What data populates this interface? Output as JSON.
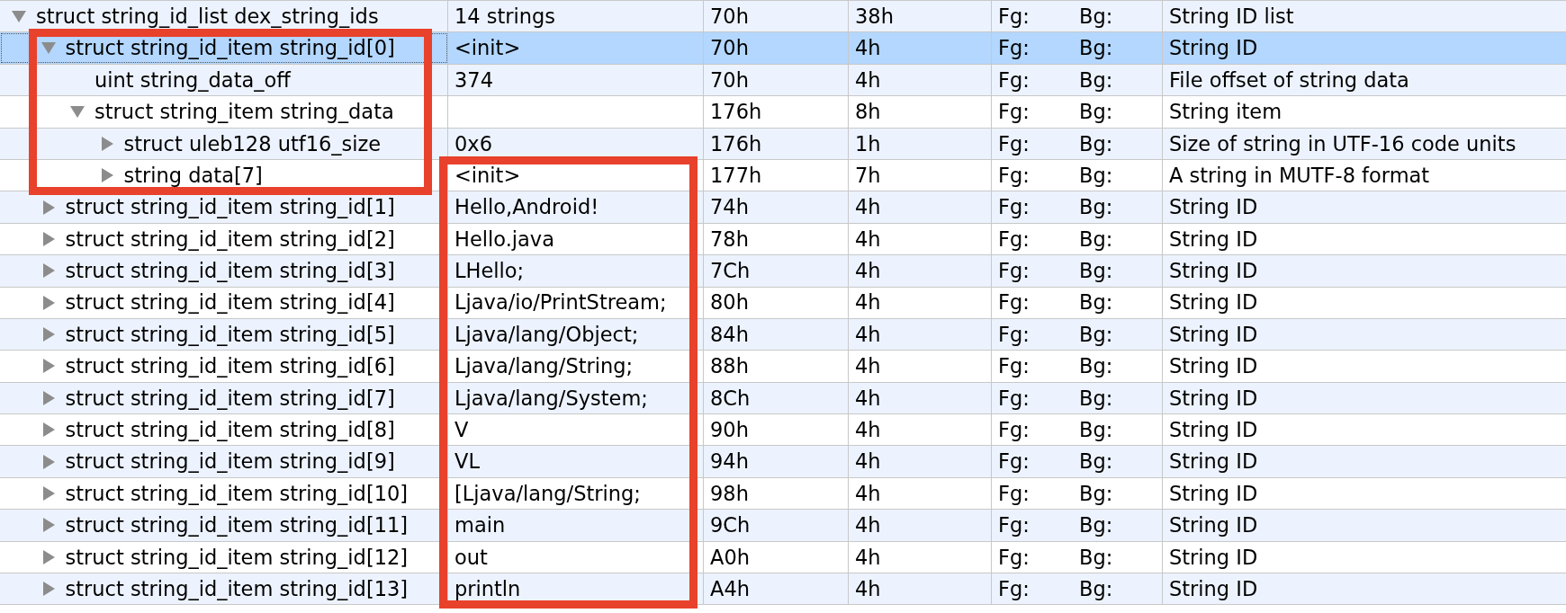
{
  "table": {
    "rows": [
      {
        "name": "struct string_id_list dex_string_ids",
        "value": "14 strings",
        "start": "70h",
        "size": "38h",
        "fg": "Fg:",
        "bg": "Bg:",
        "comment": "String ID list",
        "selected": false,
        "expanded": true,
        "name_framed": false,
        "value_framed": false,
        "children": [
          {
            "name": "struct string_id_item string_id[0]",
            "value": "<init>",
            "start": "70h",
            "size": "4h",
            "fg": "Fg:",
            "bg": "Bg:",
            "comment": "String ID",
            "selected": true,
            "expanded": true,
            "name_framed": true,
            "value_framed": false,
            "children": [
              {
                "name": "uint string_data_off",
                "value": "374",
                "start": "70h",
                "size": "4h",
                "fg": "Fg:",
                "bg": "Bg:",
                "comment": "File offset of string data",
                "selected": false,
                "name_framed": true,
                "value_framed": false
              },
              {
                "name": "struct string_item string_data",
                "start": "176h",
                "size": "8h",
                "fg": "Fg:",
                "bg": "Bg:",
                "comment": "String item",
                "selected": false,
                "expanded": true,
                "name_framed": true,
                "value_framed": false,
                "children": [
                  {
                    "name": "struct uleb128 utf16_size",
                    "value": "0x6",
                    "start": "176h",
                    "size": "1h",
                    "fg": "Fg:",
                    "bg": "Bg:",
                    "comment": "Size of string in UTF-16 code units",
                    "selected": false,
                    "expanded": false,
                    "name_framed": true,
                    "value_framed": false
                  },
                  {
                    "name": "string data[7]",
                    "value": "<init>",
                    "start": "177h",
                    "size": "7h",
                    "fg": "Fg:",
                    "bg": "Bg:",
                    "comment": "A string in MUTF-8 format",
                    "selected": false,
                    "expanded": false,
                    "name_framed": true,
                    "value_framed": true
                  }
                ]
              }
            ]
          },
          {
            "name": "struct string_id_item string_id[1]",
            "value": "Hello,Android!",
            "start": "74h",
            "size": "4h",
            "fg": "Fg:",
            "bg": "Bg:",
            "comment": "String ID",
            "selected": false,
            "expanded": false,
            "name_framed": false,
            "value_framed": true
          },
          {
            "name": "struct string_id_item string_id[2]",
            "value": "Hello.java",
            "start": "78h",
            "size": "4h",
            "fg": "Fg:",
            "bg": "Bg:",
            "comment": "String ID",
            "selected": false,
            "expanded": false,
            "name_framed": false,
            "value_framed": true
          },
          {
            "name": "struct string_id_item string_id[3]",
            "value": "LHello;",
            "start": "7Ch",
            "size": "4h",
            "fg": "Fg:",
            "bg": "Bg:",
            "comment": "String ID",
            "selected": false,
            "expanded": false,
            "name_framed": false,
            "value_framed": true
          },
          {
            "name": "struct string_id_item string_id[4]",
            "value": "Ljava/io/PrintStream;",
            "start": "80h",
            "size": "4h",
            "fg": "Fg:",
            "bg": "Bg:",
            "comment": "String ID",
            "selected": false,
            "expanded": false,
            "name_framed": false,
            "value_framed": true
          },
          {
            "name": "struct string_id_item string_id[5]",
            "value": "Ljava/lang/Object;",
            "start": "84h",
            "size": "4h",
            "fg": "Fg:",
            "bg": "Bg:",
            "comment": "String ID",
            "selected": false,
            "expanded": false,
            "name_framed": false,
            "value_framed": true
          },
          {
            "name": "struct string_id_item string_id[6]",
            "value": "Ljava/lang/String;",
            "start": "88h",
            "size": "4h",
            "fg": "Fg:",
            "bg": "Bg:",
            "comment": "String ID",
            "selected": false,
            "expanded": false,
            "name_framed": false,
            "value_framed": true
          },
          {
            "name": "struct string_id_item string_id[7]",
            "value": "Ljava/lang/System;",
            "start": "8Ch",
            "size": "4h",
            "fg": "Fg:",
            "bg": "Bg:",
            "comment": "String ID",
            "selected": false,
            "expanded": false,
            "name_framed": false,
            "value_framed": true
          },
          {
            "name": "struct string_id_item string_id[8]",
            "value": "V",
            "start": "90h",
            "size": "4h",
            "fg": "Fg:",
            "bg": "Bg:",
            "comment": "String ID",
            "selected": false,
            "expanded": false,
            "name_framed": false,
            "value_framed": true
          },
          {
            "name": "struct string_id_item string_id[9]",
            "value": "VL",
            "start": "94h",
            "size": "4h",
            "fg": "Fg:",
            "bg": "Bg:",
            "comment": "String ID",
            "selected": false,
            "expanded": false,
            "name_framed": false,
            "value_framed": true
          },
          {
            "name": "struct string_id_item string_id[10]",
            "value": "[Ljava/lang/String;",
            "start": "98h",
            "size": "4h",
            "fg": "Fg:",
            "bg": "Bg:",
            "comment": "String ID",
            "selected": false,
            "expanded": false,
            "name_framed": false,
            "value_framed": true
          },
          {
            "name": "struct string_id_item string_id[11]",
            "value": "main",
            "start": "9Ch",
            "size": "4h",
            "fg": "Fg:",
            "bg": "Bg:",
            "comment": "String ID",
            "selected": false,
            "expanded": false,
            "name_framed": false,
            "value_framed": true
          },
          {
            "name": "struct string_id_item string_id[12]",
            "value": "out",
            "start": "A0h",
            "size": "4h",
            "fg": "Fg:",
            "bg": "Bg:",
            "comment": "String ID",
            "selected": false,
            "expanded": false,
            "name_framed": false,
            "value_framed": true
          },
          {
            "name": "struct string_id_item string_id[13]",
            "value": "println",
            "start": "A4h",
            "size": "4h",
            "fg": "Fg:",
            "bg": "Bg:",
            "comment": "String ID",
            "selected": false,
            "expanded": false,
            "name_framed": false,
            "value_framed": true
          }
        ]
      }
    ]
  }
}
